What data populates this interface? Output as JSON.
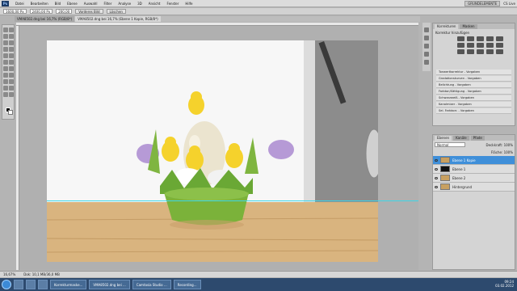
{
  "menubar": {
    "logo": "Ps",
    "items": [
      "Datei",
      "Bearbeiten",
      "Bild",
      "Ebene",
      "Auswahl",
      "Filter",
      "Analyse",
      "3D",
      "Ansicht",
      "Fenster",
      "Hilfe"
    ],
    "workspace": "GRUNDELEMENTE",
    "cslive": "CS Live"
  },
  "options": {
    "w": "1600,00 Px",
    "h": "2400,00 Px",
    "res": "200,00",
    "btn1": "Vorderes Bild",
    "btn2": "Löschen"
  },
  "tabs": [
    {
      "label": "VMA8502.dng bei 16,7% (RGB/8*)",
      "active": false
    },
    {
      "label": "VMA8502.dng bei 16,7% (Ebene 1 Kopie, RGB/8*)",
      "active": true
    }
  ],
  "status": {
    "zoom": "16,67%",
    "doc": "Dok: 10,1 MB/36,0 MB"
  },
  "adjust_panel": {
    "tabs": [
      "Korrekturen",
      "Masken"
    ],
    "title": "Korrektur hinzufügen",
    "presets": [
      "Tonwertkorrektur - Vorgaben",
      "Gradationskurven - Vorgaben",
      "Belichtung - Vorgaben",
      "Farbton/Sättigung - Vorgaben",
      "Schwarzweiß - Vorgaben",
      "Kanalmixer - Vorgaben",
      "Sel. Farbkorr. - Vorgaben"
    ]
  },
  "layers_panel": {
    "tabs": [
      "Ebenen",
      "Kanäle",
      "Pfade"
    ],
    "blend": "Normal",
    "opacity_label": "Deckkraft:",
    "opacity": "100%",
    "fill_label": "Fläche:",
    "fill": "100%",
    "layers": [
      {
        "name": "Ebene 1 Kopie",
        "selected": true
      },
      {
        "name": "Ebene 1",
        "selected": false
      },
      {
        "name": "Ebene 2",
        "selected": false
      },
      {
        "name": "Hintergrund",
        "selected": false
      }
    ]
  },
  "taskbar": {
    "buttons": [
      "Korrekturmaske...",
      "VMA8502.dng bei ...",
      "Camtasia Studio ...",
      "Recording..."
    ],
    "time": "09:24",
    "date": "03.02.2012"
  }
}
